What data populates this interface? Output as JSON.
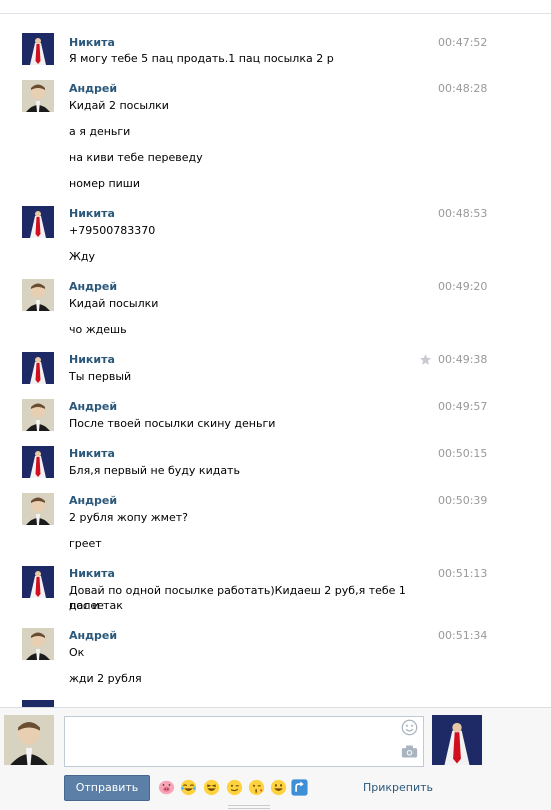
{
  "colors": {
    "author": "#2b587a",
    "time": "#999999",
    "send_button": "#5b7fa6",
    "link": "#2b587a"
  },
  "messages": [
    {
      "author": "Никита",
      "time": "00:47:52",
      "lines": [
        "Я могу тебе 5 пац продать.1 пац посылка 2 р"
      ]
    },
    {
      "author": "Андрей",
      "time": "00:48:28",
      "lines": [
        "Кидай 2 посылки",
        "а я деньги",
        "на киви тебе переведу",
        "номер пиши"
      ]
    },
    {
      "author": "Никита",
      "time": "00:48:53",
      "lines": [
        "+79500783370",
        "Жду"
      ]
    },
    {
      "author": "Андрей",
      "time": "00:49:20",
      "lines": [
        "Кидай посылки",
        "чо ждешь"
      ]
    },
    {
      "author": "Никита",
      "time": "00:49:38",
      "lines": [
        "Ты первый"
      ]
    },
    {
      "author": "Андрей",
      "time": "00:49:57",
      "lines": [
        "После твоей посылки скину деньги"
      ]
    },
    {
      "author": "Никита",
      "time": "00:50:15",
      "lines": [
        "Бля,я первый не буду кидать"
      ]
    },
    {
      "author": "Андрей",
      "time": "00:50:39",
      "lines": [
        "2 рубля жопу жмет?",
        "греет"
      ]
    },
    {
      "author": "Никита",
      "time": "00:51:13",
      "lines": [
        "Довай по одной посылке работать)Кидаеш 2 руб,я тебе 1 пос и так",
        "далее"
      ]
    },
    {
      "author": "Андрей",
      "time": "00:51:34",
      "lines": [
        "Ок",
        "жди 2 рубля"
      ]
    }
  ],
  "composer": {
    "send_label": "Отправить",
    "attach_label": "Прикрепить",
    "emoji_icons": [
      "pig-emoji-icon",
      "laughing-tears-emoji-icon",
      "grin-emoji-icon",
      "wink-emoji-icon",
      "kiss-wink-emoji-icon",
      "big-smile-emoji-icon",
      "share-arrow-icon"
    ]
  }
}
